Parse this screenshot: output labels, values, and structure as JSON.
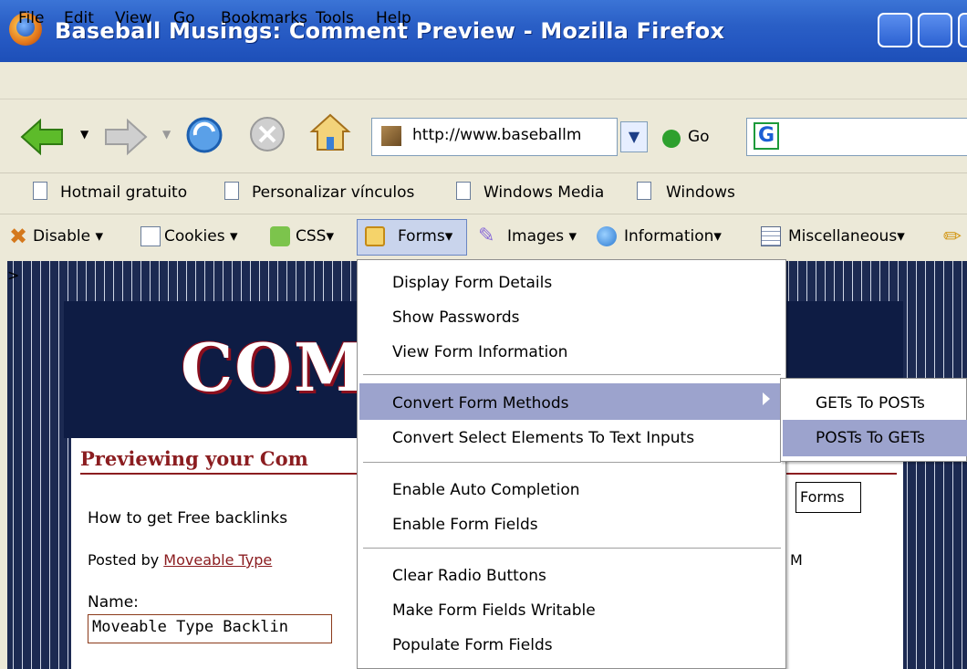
{
  "window": {
    "title": "Baseball Musings: Comment Preview - Mozilla Firefox"
  },
  "menubar": [
    "File",
    "Edit",
    "View",
    "Go",
    "Bookmarks",
    "Tools",
    "Help"
  ],
  "navbar": {
    "url": "http://www.baseballm",
    "go_label": "Go"
  },
  "bookmarks": [
    "Hotmail gratuito",
    "Personalizar vínculos",
    "Windows Media",
    "Windows"
  ],
  "webdev_toolbar": [
    "Disable",
    "Cookies",
    "CSS",
    "Forms",
    "Images",
    "Information",
    "Miscellaneous"
  ],
  "page": {
    "banner_text": "COM",
    "preview_title": "Previewing your Com",
    "comment_body": "How to get Free backlinks",
    "posted_prefix": "Posted by ",
    "posted_author": "Moveable Type",
    "posted_tail": "M",
    "name_label": "Name:",
    "name_value": "Moveable Type Backlin",
    "forms_tooltip": "Forms",
    "gt_mark": ">"
  },
  "forms_menu": {
    "items": [
      "Display Form Details",
      "Show Passwords",
      "View Form Information",
      "Convert Form Methods",
      "Convert Select Elements To Text Inputs",
      "Enable Auto Completion",
      "Enable Form Fields",
      "Clear Radio Buttons",
      "Make Form Fields Writable",
      "Populate Form Fields"
    ],
    "highlighted": "Convert Form Methods"
  },
  "submenu": {
    "items": [
      "GETs To POSTs",
      "POSTs To GETs"
    ],
    "highlighted": "POSTs To GETs"
  },
  "colors": {
    "titlebar": "#2a5fc6",
    "highlight": "#9ca3cd",
    "accent_red": "#8b1d20"
  }
}
